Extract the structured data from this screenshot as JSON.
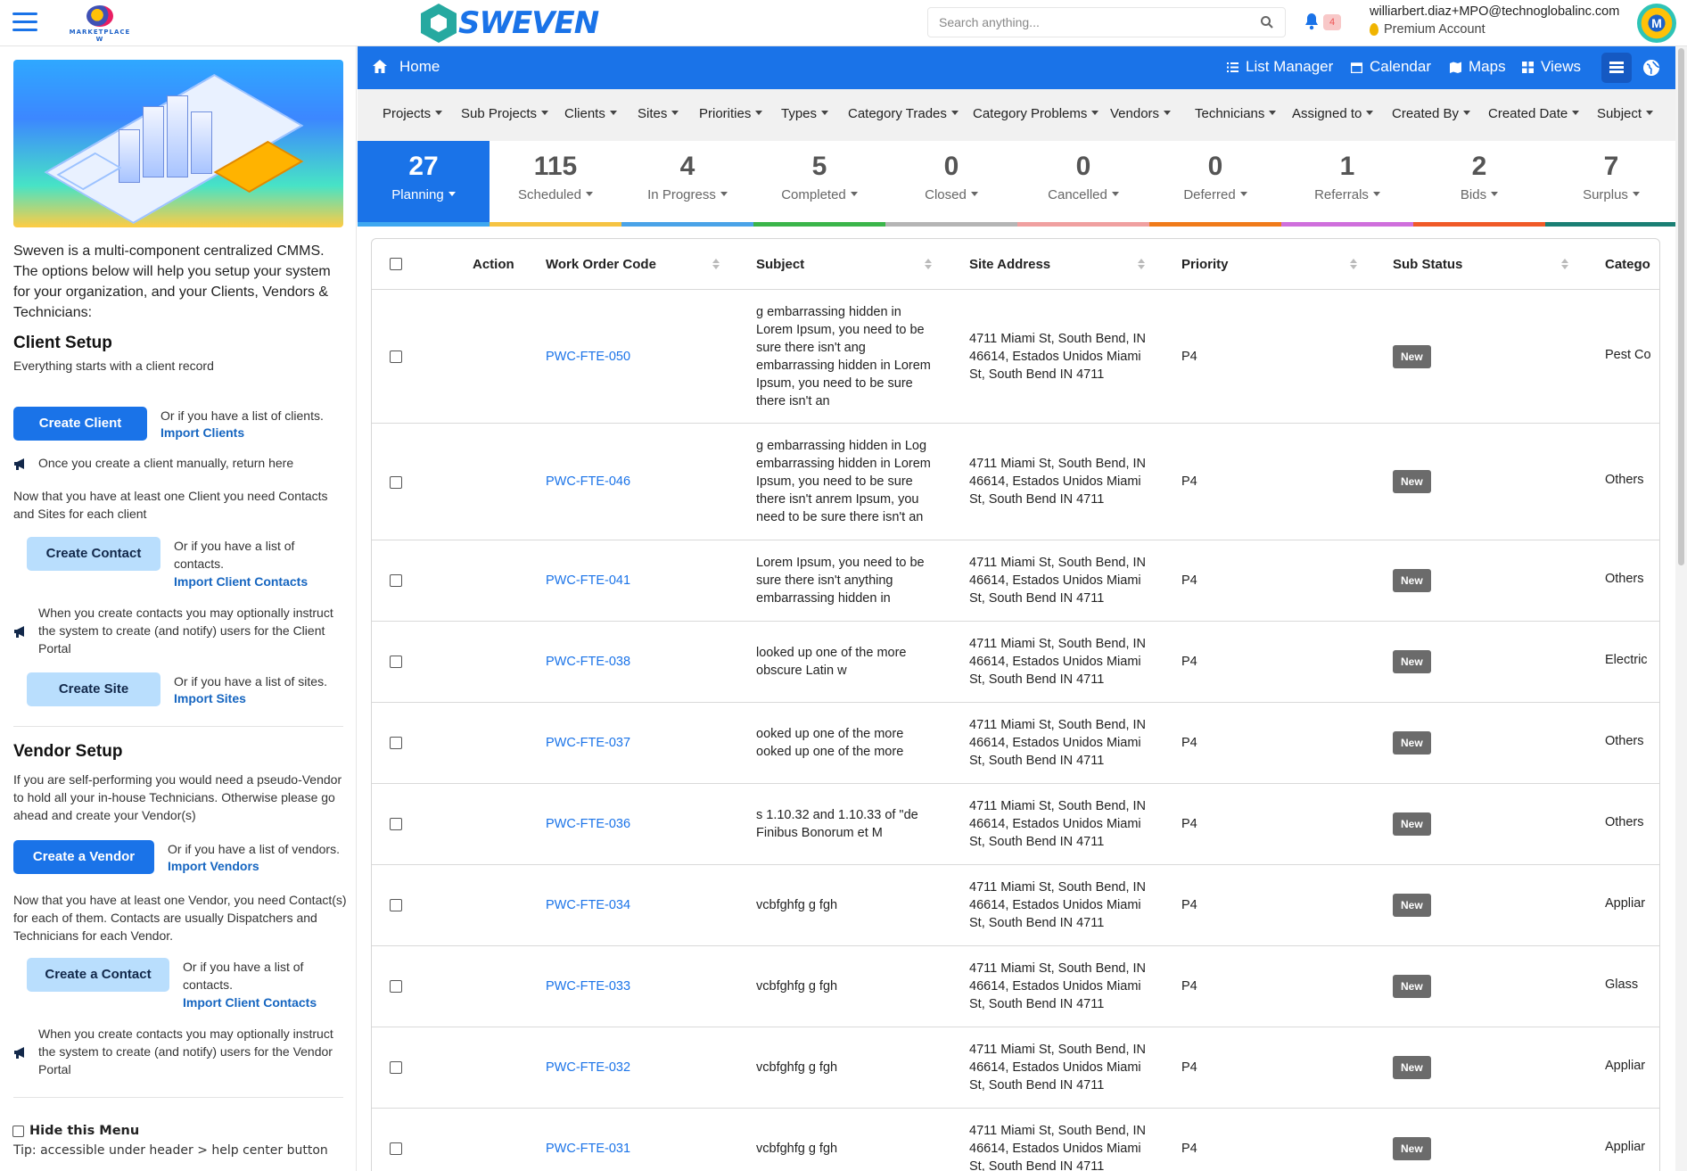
{
  "header": {
    "marketplace_logo_text": "MARKETPLACE W",
    "brand": "SWEVEN",
    "search_placeholder": "Search anything...",
    "notification_count": "4",
    "user_email": "williarbert.diaz+MPO@technoglobalinc.com",
    "account_type": "Premium Account",
    "avatar_text": "M"
  },
  "sidebar": {
    "intro": "Sweven is a multi-component centralized CMMS. The options below will help you setup your system for your organization, and your Clients, Vendors & Technicians:",
    "client_setup_title": "Client Setup",
    "client_setup_sub": "Everything starts with a client record",
    "create_client": "Create Client",
    "or_clients": "Or if you have a list of clients.",
    "import_clients": "Import Clients",
    "note_return": "Once you create a client manually, return here",
    "contacts_sites_text": "Now that you have at least one Client you need Contacts and Sites for  each client",
    "create_contact": "Create Contact",
    "or_contacts": "Or if you have a list of contacts.",
    "import_client_contacts": "Import Client Contacts",
    "note_client_portal": "When you create contacts you may optionally instruct the system to create (and notify) users for the Client Portal",
    "create_site": "Create Site",
    "or_sites": "Or if you have a list of sites.",
    "import_sites": "Import Sites",
    "vendor_setup_title": "Vendor Setup",
    "vendor_setup_text": "If you are self-performing you would need a pseudo-Vendor to hold all your in-house Technicians. Otherwise please go ahead and create your Vendor(s)",
    "create_vendor": "Create a Vendor",
    "or_vendors": "Or if you have a list of vendors.",
    "import_vendors": "Import Vendors",
    "vendor_contacts_text": "Now that you have at least one Vendor, you need Contact(s) for each of them. Contacts are usually Dispatchers and Technicians for each Vendor.",
    "create_a_contact": "Create a Contact",
    "or_contacts2": "Or if you have a list of contacts.",
    "import_client_contacts2": "Import Client Contacts",
    "note_vendor_portal": "When you create contacts you may optionally instruct the system to create (and notify) users for the Vendor Portal",
    "hide_menu": "Hide this Menu",
    "tip": "Tip: accessible under header > help center button"
  },
  "navbar": {
    "home": "Home",
    "list_manager": "List Manager",
    "calendar": "Calendar",
    "maps": "Maps",
    "views": "Views"
  },
  "filters": [
    "Projects",
    "Sub Projects",
    "Clients",
    "Sites",
    "Priorities",
    "Types",
    "Category Trades",
    "Category Problems",
    "Vendors",
    "Technicians",
    "Assigned to",
    "Created By",
    "Created Date",
    "Subject"
  ],
  "statuses": [
    {
      "count": "27",
      "label": "Planning",
      "color": "#1a73e8"
    },
    {
      "count": "115",
      "label": "Scheduled",
      "color": "#f5c342"
    },
    {
      "count": "4",
      "label": "In Progress",
      "color": "#4aa3e8"
    },
    {
      "count": "5",
      "label": "Completed",
      "color": "#3bb54a"
    },
    {
      "count": "0",
      "label": "Closed",
      "color": "#b5b5b5"
    },
    {
      "count": "0",
      "label": "Cancelled",
      "color": "#f0a0a0"
    },
    {
      "count": "0",
      "label": "Deferred",
      "color": "#f07b1a"
    },
    {
      "count": "1",
      "label": "Referrals",
      "color": "#cf6fdc"
    },
    {
      "count": "2",
      "label": "Bids",
      "color": "#f05a28"
    },
    {
      "count": "7",
      "label": "Surplus",
      "color": "#1a7f74"
    }
  ],
  "table": {
    "headers": {
      "action": "Action",
      "code": "Work Order Code",
      "subject": "Subject",
      "address": "Site Address",
      "priority": "Priority",
      "sub_status": "Sub Status",
      "category": "Catego"
    },
    "rows": [
      {
        "code": "PWC-FTE-050",
        "subject": "g embarrassing hidden in Lorem Ipsum, you need to be sure there isn't ang embarrassing hidden in Lorem Ipsum, you need to be sure there isn't an",
        "address": "4711 Miami St, South Bend, IN 46614, Estados Unidos Miami St, South Bend IN 4711",
        "priority": "P4",
        "sub_status": "New",
        "category": "Pest Co"
      },
      {
        "code": "PWC-FTE-046",
        "subject": "g embarrassing hidden in Log embarrassing hidden in Lorem Ipsum, you need to be sure there isn't anrem Ipsum, you need to be sure there isn't an",
        "address": "4711 Miami St, South Bend, IN 46614, Estados Unidos Miami St, South Bend IN 4711",
        "priority": "P4",
        "sub_status": "New",
        "category": "Others"
      },
      {
        "code": "PWC-FTE-041",
        "subject": "Lorem Ipsum, you need to be sure there isn't anything embarrassing hidden in",
        "address": "4711 Miami St, South Bend, IN 46614, Estados Unidos Miami St, South Bend IN 4711",
        "priority": "P4",
        "sub_status": "New",
        "category": "Others"
      },
      {
        "code": "PWC-FTE-038",
        "subject": "looked up one of the more obscure Latin w",
        "address": "4711 Miami St, South Bend, IN 46614, Estados Unidos Miami St, South Bend IN 4711",
        "priority": "P4",
        "sub_status": "New",
        "category": "Electric"
      },
      {
        "code": "PWC-FTE-037",
        "subject": "ooked up one of the more ooked up one of the more",
        "address": "4711 Miami St, South Bend, IN 46614, Estados Unidos Miami St, South Bend IN 4711",
        "priority": "P4",
        "sub_status": "New",
        "category": "Others"
      },
      {
        "code": "PWC-FTE-036",
        "subject": "s 1.10.32 and 1.10.33 of \"de Finibus Bonorum et M",
        "address": "4711 Miami St, South Bend, IN 46614, Estados Unidos Miami St, South Bend IN 4711",
        "priority": "P4",
        "sub_status": "New",
        "category": "Others"
      },
      {
        "code": "PWC-FTE-034",
        "subject": "vcbfghfg g fgh",
        "address": "4711 Miami St, South Bend, IN 46614, Estados Unidos Miami St, South Bend IN 4711",
        "priority": "P4",
        "sub_status": "New",
        "category": "Appliar"
      },
      {
        "code": "PWC-FTE-033",
        "subject": "vcbfghfg g fgh",
        "address": "4711 Miami St, South Bend, IN 46614, Estados Unidos Miami St, South Bend IN 4711",
        "priority": "P4",
        "sub_status": "New",
        "category": "Glass"
      },
      {
        "code": "PWC-FTE-032",
        "subject": "vcbfghfg g fgh",
        "address": "4711 Miami St, South Bend, IN 46614, Estados Unidos Miami St, South Bend IN 4711",
        "priority": "P4",
        "sub_status": "New",
        "category": "Appliar"
      },
      {
        "code": "PWC-FTE-031",
        "subject": "vcbfghfg g fgh",
        "address": "4711 Miami St, South Bend, IN 46614, Estados Unidos Miami St, South Bend IN 4711",
        "priority": "P4",
        "sub_status": "New",
        "category": "Appliar"
      }
    ]
  },
  "icons": [
    "hamburger-icon",
    "search-icon",
    "bell-icon",
    "home-icon",
    "list-icon",
    "calendar-icon",
    "map-icon",
    "views-icon",
    "table-view-icon",
    "globe-icon",
    "megaphone-icon"
  ]
}
